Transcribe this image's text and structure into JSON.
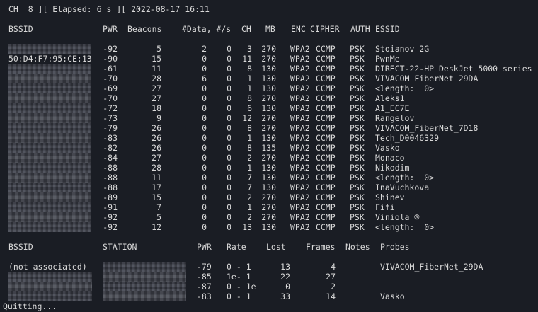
{
  "status_line": "CH  8 ][ Elapsed: 6 s ][ 2022-08-17 16:11",
  "ap_headers": {
    "bssid": "BSSID",
    "pwr": "PWR",
    "beacons": "Beacons",
    "data": "#Data, #/s",
    "ch": "CH",
    "mb": "MB",
    "enc": "ENC",
    "cipher": "CIPHER",
    "auth": "AUTH",
    "essid": "ESSID"
  },
  "access_points": [
    {
      "bssid": "",
      "pwr": "-92",
      "beacons": "5",
      "data": "2",
      "rate": "0",
      "ch": "3",
      "mb": "270",
      "enc": "WPA2",
      "cipher": "CCMP",
      "auth": "PSK",
      "essid": "Stoianov 2G"
    },
    {
      "bssid": "50:D4:F7:95:CE:13",
      "pwr": "-90",
      "beacons": "15",
      "data": "0",
      "rate": "0",
      "ch": "11",
      "mb": "270",
      "enc": "WPA2",
      "cipher": "CCMP",
      "auth": "PSK",
      "essid": "PwnMe"
    },
    {
      "bssid": "",
      "pwr": "-61",
      "beacons": "11",
      "data": "0",
      "rate": "0",
      "ch": "8",
      "mb": "130",
      "enc": "WPA2",
      "cipher": "CCMP",
      "auth": "PSK",
      "essid": "DIRECT-22-HP DeskJet 5000 series"
    },
    {
      "bssid": "",
      "pwr": "-70",
      "beacons": "28",
      "data": "6",
      "rate": "0",
      "ch": "1",
      "mb": "130",
      "enc": "WPA2",
      "cipher": "CCMP",
      "auth": "PSK",
      "essid": "VIVACOM_FiberNet_29DA"
    },
    {
      "bssid": "",
      "pwr": "-69",
      "beacons": "27",
      "data": "0",
      "rate": "0",
      "ch": "1",
      "mb": "130",
      "enc": "WPA2",
      "cipher": "CCMP",
      "auth": "PSK",
      "essid": "<length:  0>"
    },
    {
      "bssid": "",
      "pwr": "-70",
      "beacons": "27",
      "data": "0",
      "rate": "0",
      "ch": "8",
      "mb": "270",
      "enc": "WPA2",
      "cipher": "CCMP",
      "auth": "PSK",
      "essid": "Aleks1"
    },
    {
      "bssid": "",
      "pwr": "-72",
      "beacons": "18",
      "data": "0",
      "rate": "0",
      "ch": "6",
      "mb": "130",
      "enc": "WPA2",
      "cipher": "CCMP",
      "auth": "PSK",
      "essid": "A1_EC7E"
    },
    {
      "bssid": "",
      "pwr": "-73",
      "beacons": "9",
      "data": "0",
      "rate": "0",
      "ch": "12",
      "mb": "270",
      "enc": "WPA2",
      "cipher": "CCMP",
      "auth": "PSK",
      "essid": "Rangelov"
    },
    {
      "bssid": "",
      "pwr": "-79",
      "beacons": "26",
      "data": "0",
      "rate": "0",
      "ch": "8",
      "mb": "270",
      "enc": "WPA2",
      "cipher": "CCMP",
      "auth": "PSK",
      "essid": "VIVACOM_FiberNet_7D18"
    },
    {
      "bssid": "",
      "pwr": "-83",
      "beacons": "26",
      "data": "0",
      "rate": "0",
      "ch": "1",
      "mb": "130",
      "enc": "WPA2",
      "cipher": "CCMP",
      "auth": "PSK",
      "essid": "Tech_D0046329"
    },
    {
      "bssid": "",
      "pwr": "-82",
      "beacons": "26",
      "data": "0",
      "rate": "0",
      "ch": "8",
      "mb": "135",
      "enc": "WPA2",
      "cipher": "CCMP",
      "auth": "PSK",
      "essid": "Vasko"
    },
    {
      "bssid": "",
      "pwr": "-84",
      "beacons": "27",
      "data": "0",
      "rate": "0",
      "ch": "2",
      "mb": "270",
      "enc": "WPA2",
      "cipher": "CCMP",
      "auth": "PSK",
      "essid": "Monaco"
    },
    {
      "bssid": "",
      "pwr": "-88",
      "beacons": "28",
      "data": "0",
      "rate": "0",
      "ch": "1",
      "mb": "130",
      "enc": "WPA2",
      "cipher": "CCMP",
      "auth": "PSK",
      "essid": "Nikodim"
    },
    {
      "bssid": "",
      "pwr": "-88",
      "beacons": "11",
      "data": "0",
      "rate": "0",
      "ch": "7",
      "mb": "130",
      "enc": "WPA2",
      "cipher": "CCMP",
      "auth": "PSK",
      "essid": "<length:  0>"
    },
    {
      "bssid": "",
      "pwr": "-88",
      "beacons": "17",
      "data": "0",
      "rate": "0",
      "ch": "7",
      "mb": "130",
      "enc": "WPA2",
      "cipher": "CCMP",
      "auth": "PSK",
      "essid": "InaVuchkova"
    },
    {
      "bssid": "",
      "pwr": "-89",
      "beacons": "15",
      "data": "0",
      "rate": "0",
      "ch": "2",
      "mb": "270",
      "enc": "WPA2",
      "cipher": "CCMP",
      "auth": "PSK",
      "essid": "Shinev"
    },
    {
      "bssid": "",
      "pwr": "-91",
      "beacons": "7",
      "data": "0",
      "rate": "0",
      "ch": "1",
      "mb": "270",
      "enc": "WPA2",
      "cipher": "CCMP",
      "auth": "PSK",
      "essid": "Fifi"
    },
    {
      "bssid": "",
      "pwr": "-92",
      "beacons": "5",
      "data": "0",
      "rate": "0",
      "ch": "2",
      "mb": "270",
      "enc": "WPA2",
      "cipher": "CCMP",
      "auth": "PSK",
      "essid": "Viniola ®"
    },
    {
      "bssid": "",
      "pwr": "-92",
      "beacons": "12",
      "data": "0",
      "rate": "0",
      "ch": "13",
      "mb": "130",
      "enc": "WPA2",
      "cipher": "CCMP",
      "auth": "PSK",
      "essid": "<length:  0>"
    }
  ],
  "station_headers": {
    "bssid": "BSSID",
    "station": "STATION",
    "pwr": "PWR",
    "rate": "Rate",
    "lost": "Lost",
    "frames": "Frames",
    "notes": "Notes",
    "probes": "Probes"
  },
  "stations": [
    {
      "bssid": "(not associated)",
      "station": "",
      "pwr": "-79",
      "rate": "0 - 1",
      "lost": "13",
      "frames": "4",
      "notes": "",
      "probes": "VIVACOM_FiberNet_29DA"
    },
    {
      "bssid": "",
      "station": "",
      "pwr": "-85",
      "rate": "1e- 1",
      "lost": "22",
      "frames": "27",
      "notes": "",
      "probes": ""
    },
    {
      "bssid": "",
      "station": "",
      "pwr": "-87",
      "rate": "0 - 1e",
      "lost": "0",
      "frames": "2",
      "notes": "",
      "probes": ""
    },
    {
      "bssid": "",
      "station": "",
      "pwr": "-83",
      "rate": "0 - 1",
      "lost": "33",
      "frames": "14",
      "notes": "",
      "probes": "Vasko"
    }
  ],
  "footer_line": "Quitting...",
  "colors": {
    "background": "#1a1d24",
    "text": "#d9d9d9",
    "redaction": "#3e414b"
  }
}
